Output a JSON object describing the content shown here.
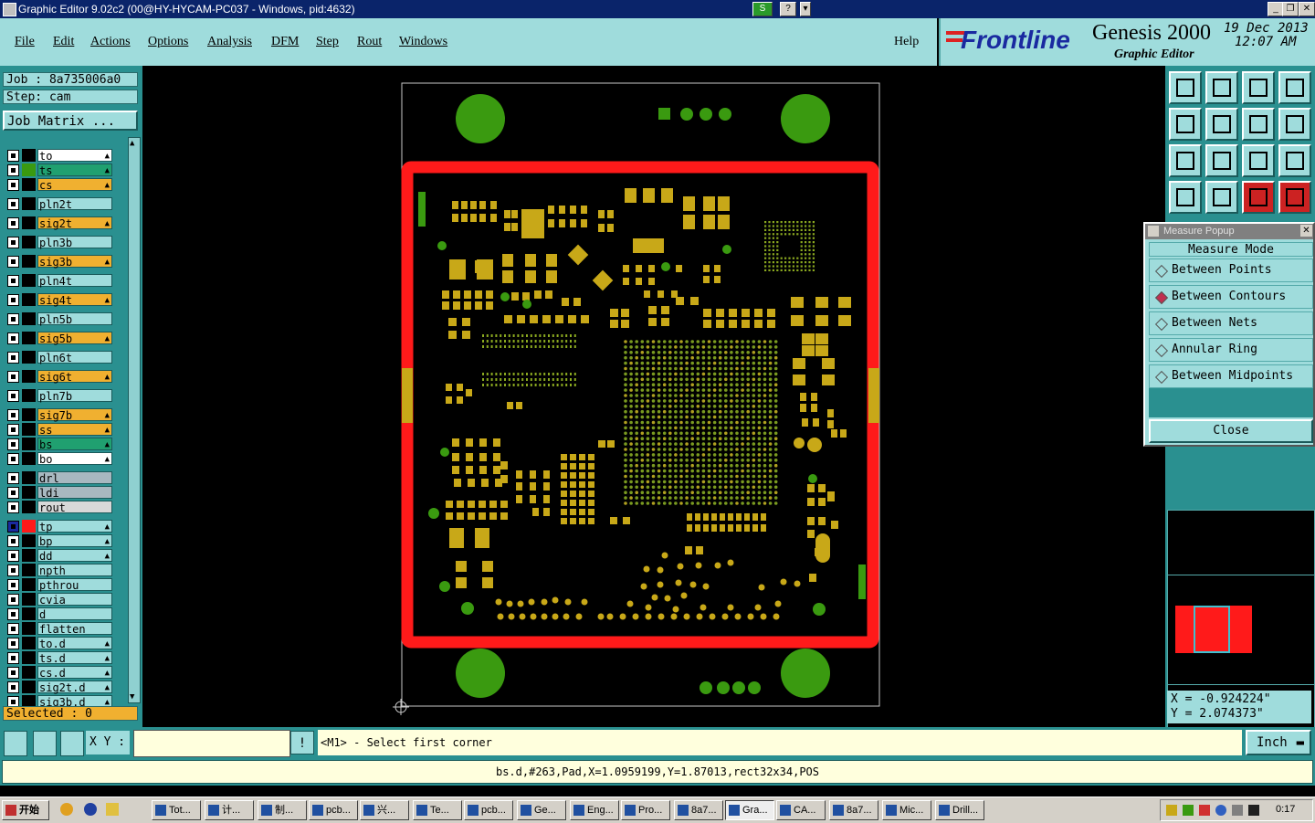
{
  "window": {
    "title": "Graphic Editor 9.02c2 (00@HY-HYCAM-PC037 - Windows, pid:4632)"
  },
  "menu": [
    "File",
    "Edit",
    "Actions",
    "Options",
    "Analysis",
    "DFM",
    "Step",
    "Rout",
    "Windows"
  ],
  "help_label": "Help",
  "brand": {
    "logo": "Frontline",
    "product": "Genesis 2000",
    "subtitle": "Graphic Editor",
    "date": "19 Dec 2013",
    "time": "12:07 AM"
  },
  "job": {
    "job_label": "Job : 8a735006a0",
    "step_label": "Step: cam",
    "matrix_button": "Job Matrix ..."
  },
  "colors": {
    "board_red": "#ff1a1a",
    "pad_green": "#3a9a10",
    "pad_gold": "#c8a818",
    "panel_teal": "#2a9090",
    "panel_light": "#9fdcdc"
  },
  "layers": [
    {
      "name": "to",
      "color": "#000000",
      "bg": "#ffffff",
      "mark": "▲"
    },
    {
      "name": "ts",
      "color": "#3a9a10",
      "bg": "#20a070",
      "mark": "▲"
    },
    {
      "name": "cs",
      "color": "#000000",
      "bg": "#f0b030",
      "mark": "▲"
    },
    {
      "name": "pln2t",
      "color": "#000000",
      "bg": "#9fdcdc",
      "mark": ""
    },
    {
      "name": "sig2t",
      "color": "#000000",
      "bg": "#f0b030",
      "mark": "▲"
    },
    {
      "name": "pln3b",
      "color": "#000000",
      "bg": "#9fdcdc",
      "mark": ""
    },
    {
      "name": "sig3b",
      "color": "#000000",
      "bg": "#f0b030",
      "mark": "▲"
    },
    {
      "name": "pln4t",
      "color": "#000000",
      "bg": "#9fdcdc",
      "mark": ""
    },
    {
      "name": "sig4t",
      "color": "#000000",
      "bg": "#f0b030",
      "mark": "▲"
    },
    {
      "name": "pln5b",
      "color": "#000000",
      "bg": "#9fdcdc",
      "mark": ""
    },
    {
      "name": "sig5b",
      "color": "#000000",
      "bg": "#f0b030",
      "mark": "▲"
    },
    {
      "name": "pln6t",
      "color": "#000000",
      "bg": "#9fdcdc",
      "mark": ""
    },
    {
      "name": "sig6t",
      "color": "#000000",
      "bg": "#f0b030",
      "mark": "▲"
    },
    {
      "name": "pln7b",
      "color": "#000000",
      "bg": "#9fdcdc",
      "mark": ""
    },
    {
      "name": "sig7b",
      "color": "#000000",
      "bg": "#f0b030",
      "mark": "▲"
    },
    {
      "name": "ss",
      "color": "#000000",
      "bg": "#f0b030",
      "mark": "▲"
    },
    {
      "name": "bs",
      "color": "#000000",
      "bg": "#20a070",
      "mark": "▲"
    },
    {
      "name": "bo",
      "color": "#000000",
      "bg": "#ffffff",
      "mark": "▲"
    },
    {
      "name": "drl",
      "color": "#000000",
      "bg": "#a8b8c0",
      "mark": ""
    },
    {
      "name": "ldi",
      "color": "#000000",
      "bg": "#a8b8c0",
      "mark": ""
    },
    {
      "name": "rout",
      "color": "#000000",
      "bg": "#d8d8d8",
      "mark": ""
    },
    {
      "name": "tp",
      "color": "#ff1a1a",
      "bg": "#9fdcdc",
      "mark": "▲"
    },
    {
      "name": "bp",
      "color": "#000000",
      "bg": "#9fdcdc",
      "mark": "▲"
    },
    {
      "name": "dd",
      "color": "#000000",
      "bg": "#9fdcdc",
      "mark": "▲"
    },
    {
      "name": "npth",
      "color": "#000000",
      "bg": "#9fdcdc",
      "mark": ""
    },
    {
      "name": "pthrou",
      "color": "#000000",
      "bg": "#9fdcdc",
      "mark": ""
    },
    {
      "name": "cvia",
      "color": "#000000",
      "bg": "#9fdcdc",
      "mark": ""
    },
    {
      "name": "d",
      "color": "#000000",
      "bg": "#9fdcdc",
      "mark": ""
    },
    {
      "name": "flatten",
      "color": "#000000",
      "bg": "#9fdcdc",
      "mark": ""
    },
    {
      "name": "to.d",
      "color": "#000000",
      "bg": "#9fdcdc",
      "mark": "▲"
    },
    {
      "name": "ts.d",
      "color": "#000000",
      "bg": "#9fdcdc",
      "mark": "▲"
    },
    {
      "name": "cs.d",
      "color": "#000000",
      "bg": "#9fdcdc",
      "mark": "▲"
    },
    {
      "name": "sig2t.d",
      "color": "#000000",
      "bg": "#9fdcdc",
      "mark": "▲"
    },
    {
      "name": "sig3b.d",
      "color": "#000000",
      "bg": "#9fdcdc",
      "mark": "▲"
    }
  ],
  "selected_label": "Selected : 0",
  "measure": {
    "title": "Measure Popup",
    "header": "Measure Mode",
    "options": [
      "Between Points",
      "Between Contours",
      "Between Nets",
      "Annular Ring",
      "Between Midpoints"
    ],
    "selected": "Between Contours",
    "close": "Close"
  },
  "coords": {
    "x": "X = -0.924224\"",
    "y": "Y = 2.074373\""
  },
  "command": {
    "xy_label": "X Y :",
    "xy_value": "",
    "prompt": "<M1> - Select first corner",
    "units": "Inch"
  },
  "status": "bs.d,#263,Pad,X=1.0959199,Y=1.87013,rect32x34,POS",
  "taskbar": {
    "start": "开始",
    "tasks": [
      "Tot...",
      "计...",
      "制...",
      "pcb...",
      "兴...",
      "Te...",
      "pcb...",
      "Ge...",
      "Eng...",
      "Pro...",
      "8a7...",
      "Gra...",
      "CA...",
      "8a7...",
      "Mic...",
      "Drill..."
    ],
    "active": "Gra...",
    "clock": "0:17"
  }
}
